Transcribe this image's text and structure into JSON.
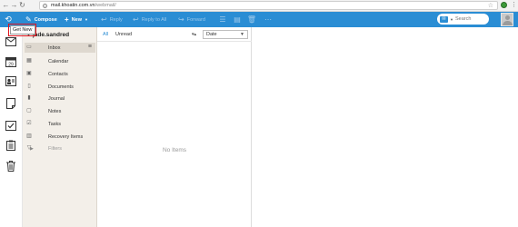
{
  "browser": {
    "url_host": "mail.khoatin.com.vn",
    "url_path": "/webmail/"
  },
  "toolbar": {
    "compose_label": "Compose",
    "new_label": "New",
    "reply_label": "Reply",
    "reply_all_label": "Reply to All",
    "forward_label": "Forward",
    "search_placeholder": "Search"
  },
  "tooltip": {
    "text": "Get New"
  },
  "rail": {
    "icons": [
      "mail-icon",
      "calendar-icon",
      "contacts-icon",
      "notes-icon",
      "tasks-icon",
      "clipboard-icon",
      "trash-icon"
    ]
  },
  "folders": {
    "account": "jade.sandred",
    "items": [
      {
        "label": "Inbox",
        "icon": "inbox-icon"
      },
      {
        "label": "Calendar",
        "icon": "calendar-icon"
      },
      {
        "label": "Contacts",
        "icon": "contacts-icon"
      },
      {
        "label": "Documents",
        "icon": "documents-icon"
      },
      {
        "label": "Journal",
        "icon": "journal-icon"
      },
      {
        "label": "Notes",
        "icon": "notes-icon"
      },
      {
        "label": "Tasks",
        "icon": "tasks-icon"
      },
      {
        "label": "Recovery Items",
        "icon": "recovery-icon"
      },
      {
        "label": "Filters",
        "icon": "filter-icon"
      }
    ]
  },
  "message_list": {
    "filter_all": "All",
    "filter_unread": "Unread",
    "sort_value": "Date",
    "empty_text": "No Items"
  }
}
